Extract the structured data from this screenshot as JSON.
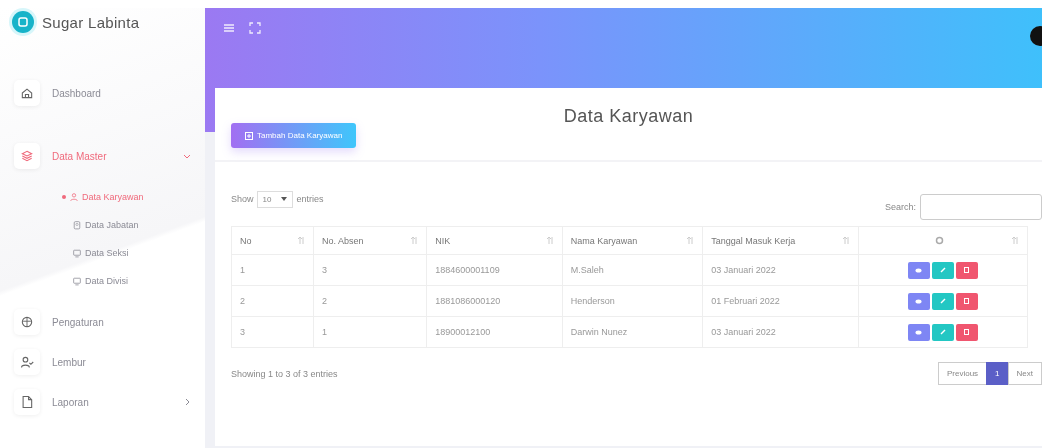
{
  "sidebar": {
    "brand": "Sugar Labinta",
    "items": [
      {
        "label": "Dashboard",
        "selected": false
      },
      {
        "label": "Data Master",
        "selected": true,
        "expanded": true,
        "children": [
          {
            "label": "Data Karyawan",
            "selected": true
          },
          {
            "label": "Data Jabatan",
            "selected": false
          },
          {
            "label": "Data Seksi",
            "selected": false
          },
          {
            "label": "Data Divisi",
            "selected": false
          }
        ]
      },
      {
        "label": "Pengaturan",
        "selected": false
      },
      {
        "label": "Lembur",
        "selected": false
      },
      {
        "label": "Laporan",
        "selected": false,
        "expanded": false
      }
    ]
  },
  "page": {
    "title": "Data Karyawan",
    "add_button": "Tambah Data Karyawan",
    "length": {
      "label_before": "Show",
      "value": "10",
      "label_after": "entries"
    },
    "search": {
      "label": "Search:"
    },
    "table": {
      "columns": [
        "No",
        "No. Absen",
        "NIK",
        "Nama Karyawan",
        "Tanggal Masuk Kerja"
      ],
      "rows": [
        [
          "1",
          "3",
          "1884600001109",
          "M.Saleh",
          "03 Januari 2022"
        ],
        [
          "2",
          "2",
          "1881086000120",
          "Henderson",
          "01 Februari 2022"
        ],
        [
          "3",
          "1",
          "18900012100",
          "Darwin Nunez",
          "03 Januari 2022"
        ]
      ]
    },
    "info": "Showing 1 to 3 of 3 entries",
    "pagination": [
      {
        "label": "Previous",
        "selected": false
      },
      {
        "label": "1",
        "selected": true
      },
      {
        "label": "Next",
        "selected": false
      }
    ]
  }
}
